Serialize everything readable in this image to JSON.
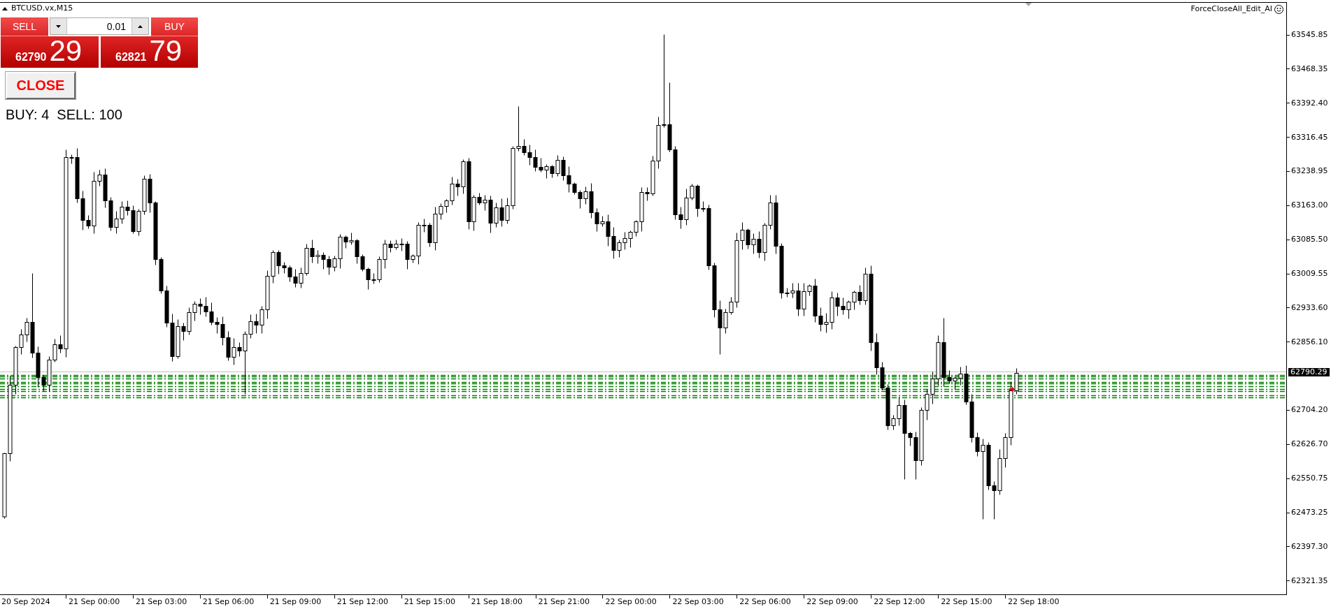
{
  "chart": {
    "symbol_title": "BTCUSD.vx,M15",
    "expert_name": "ForceCloseAll_Edit_AI"
  },
  "trade_panel": {
    "sell": {
      "label": "SELL",
      "price_major": "62790",
      "price_minor": "29"
    },
    "lot_size": {
      "value": "0.01"
    },
    "buy": {
      "label": "BUY",
      "price_major": "62821",
      "price_minor": "79"
    }
  },
  "close_button": {
    "label": "CLOSE"
  },
  "position_counts": "BUY: 4  SELL: 100",
  "price_axis": {
    "items": [
      {
        "kind": "tick",
        "label": "63545.85"
      },
      {
        "kind": "tick",
        "label": "63468.35"
      },
      {
        "kind": "tick",
        "label": "63392.40"
      },
      {
        "kind": "tick",
        "label": "63316.45"
      },
      {
        "kind": "tick",
        "label": "63238.95"
      },
      {
        "kind": "tick",
        "label": "63163.00"
      },
      {
        "kind": "tick",
        "label": "63085.50"
      },
      {
        "kind": "tick",
        "label": "63009.55"
      },
      {
        "kind": "tick",
        "label": "62933.60"
      },
      {
        "kind": "tick",
        "label": "62856.10"
      },
      {
        "kind": "current",
        "label": "62790.29"
      },
      {
        "kind": "tick",
        "label": "62704.20"
      },
      {
        "kind": "tick",
        "label": "62626.70"
      },
      {
        "kind": "tick",
        "label": "62550.75"
      },
      {
        "kind": "tick",
        "label": "62473.25"
      },
      {
        "kind": "tick",
        "label": "62397.30"
      },
      {
        "kind": "tick",
        "label": "62321.35"
      }
    ]
  },
  "time_axis": {
    "labels": [
      "20 Sep 2024",
      "21 Sep 00:00",
      "21 Sep 03:00",
      "21 Sep 06:00",
      "21 Sep 09:00",
      "21 Sep 12:00",
      "21 Sep 15:00",
      "21 Sep 18:00",
      "21 Sep 21:00",
      "22 Sep 00:00",
      "22 Sep 03:00",
      "22 Sep 06:00",
      "22 Sep 09:00",
      "22 Sep 12:00",
      "22 Sep 15:00",
      "22 Sep 18:00"
    ]
  }
}
